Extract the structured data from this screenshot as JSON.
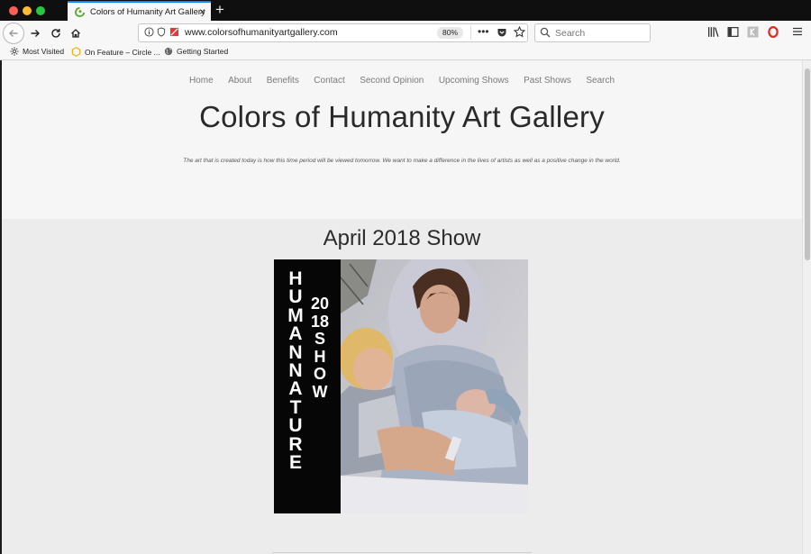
{
  "browser": {
    "tab_title": "Colors of Humanity Art Gallery",
    "tab_close": "×",
    "new_tab": "+",
    "url": "www.colorsofhumanityartgallery.com",
    "zoom": "80%",
    "url_more": "•••",
    "search_placeholder": "Search",
    "bookmarks": [
      {
        "label": "Most Visited",
        "icon": "gear-icon"
      },
      {
        "label": "On Feature – Circle ...",
        "icon": "hexagon-icon"
      },
      {
        "label": "Getting Started",
        "icon": "globe-icon"
      }
    ],
    "colors": {
      "accent": "#0a84ff",
      "tab_bar": "#0f0f0f",
      "toolbar": "#f7f7f7"
    }
  },
  "site": {
    "nav": [
      "Home",
      "About",
      "Benefits",
      "Contact",
      "Second Opinion",
      "Upcoming Shows",
      "Past Shows",
      "Search"
    ],
    "title": "Colors of Humanity Art Gallery",
    "tagline": "The art that is created today is how this time period will be viewed tomorrow. We want to make a difference in the lives of artists as well as a positive change in the world.",
    "show_title": "April 2018 Show",
    "poster": {
      "text_col1": "HUMANNATURE",
      "text_col2": "2018SHOW"
    }
  }
}
